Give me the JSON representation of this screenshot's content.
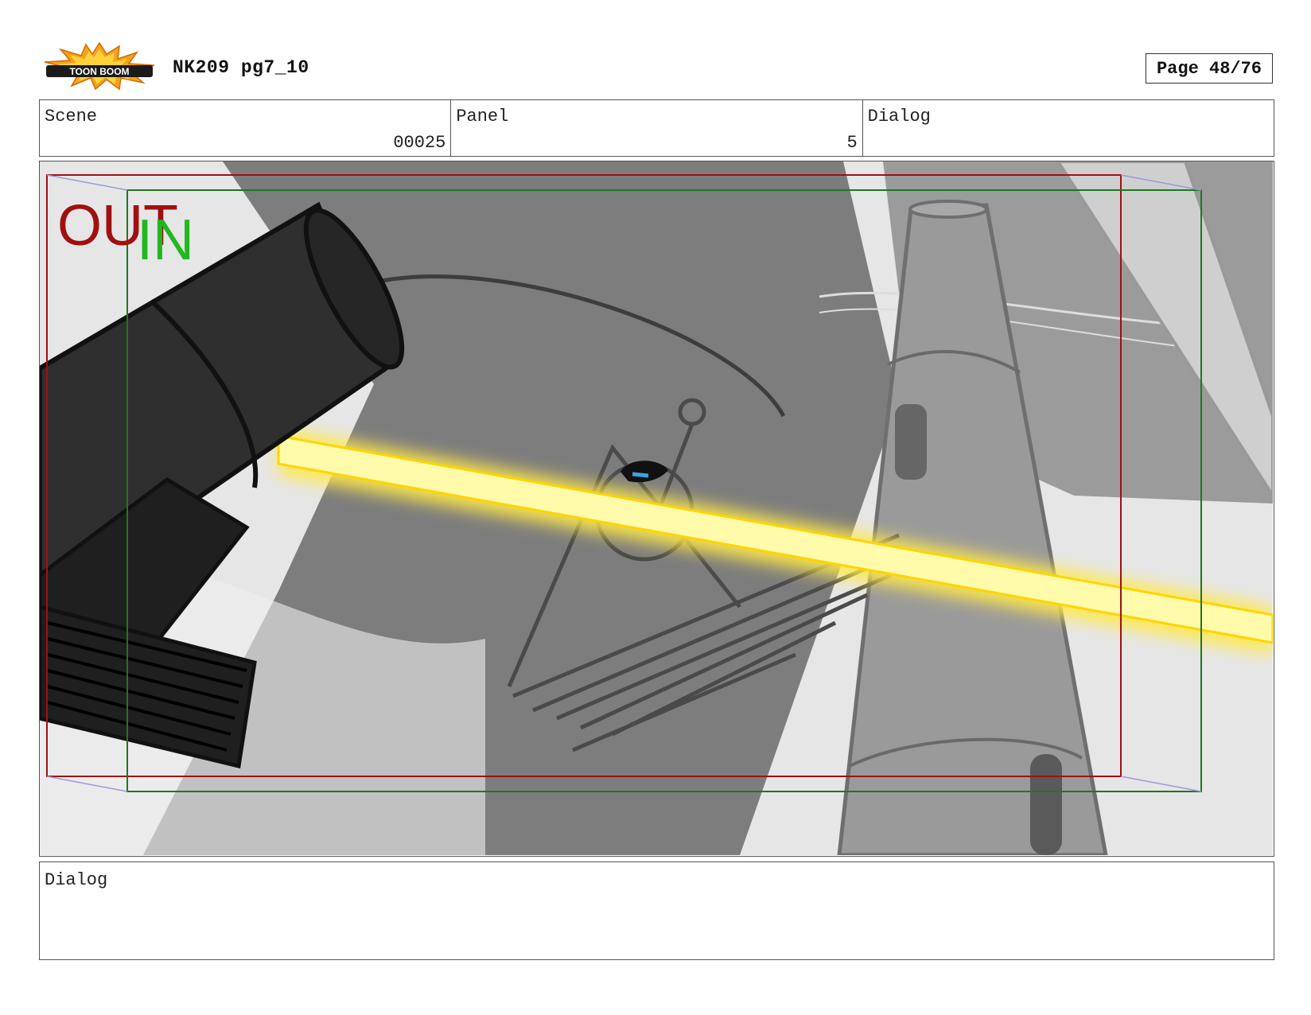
{
  "header": {
    "logo_text": "TOON BOOM",
    "title": "NK209 pg7_10",
    "page": "Page 48/76"
  },
  "info": {
    "scene_label": "Scene",
    "scene_value": "00025",
    "panel_label": "Panel",
    "panel_value": "5",
    "dialog_label": "Dialog",
    "dialog_value": ""
  },
  "panel": {
    "out_label": "OUT",
    "in_label": "IN",
    "colors": {
      "out_frame": "#a01010",
      "in_frame": "#1a7a1a",
      "beam": "#fff27a"
    }
  },
  "dialog": {
    "label": "Dialog",
    "text": ""
  }
}
